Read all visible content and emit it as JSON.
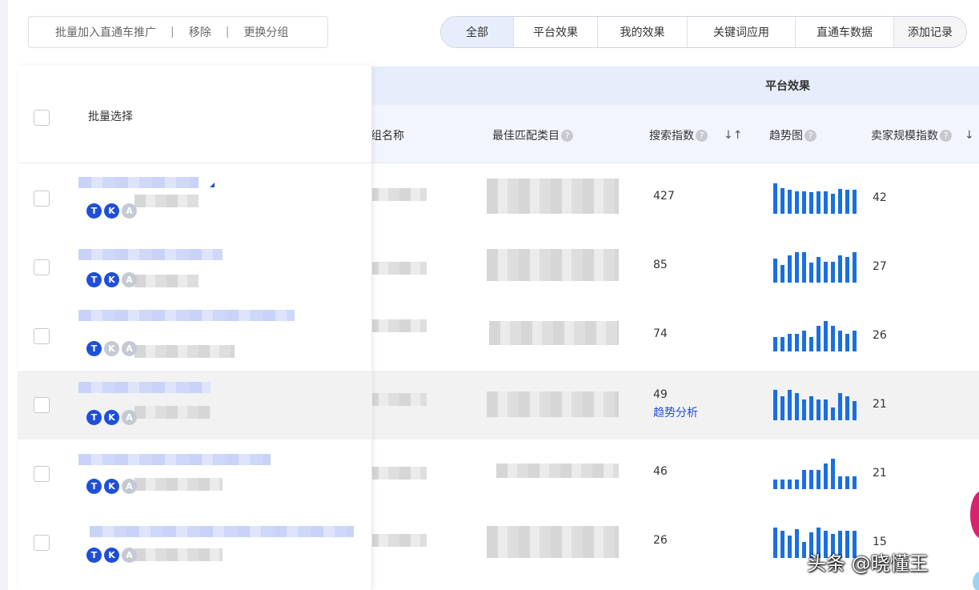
{
  "toolbar": {
    "batch_add": "批量加入直通车推广",
    "remove": "移除",
    "change_group": "更换分组"
  },
  "tabs": [
    {
      "label": "全部",
      "active": true
    },
    {
      "label": "平台效果",
      "active": false
    },
    {
      "label": "我的效果",
      "active": false
    },
    {
      "label": "关键词应用",
      "active": false
    },
    {
      "label": "直通车数据",
      "active": false
    },
    {
      "label": "添加记录",
      "active": false
    }
  ],
  "table": {
    "batch_select_label": "批量选择",
    "group_header": "平台效果",
    "columns": {
      "group_name": "组名称",
      "best_category": "最佳匹配类目",
      "search_index": "搜索指数",
      "trend_chart": "趋势图",
      "seller_scale": "卖家规模指数"
    },
    "trend_analysis_link": "趋势分析",
    "rows": [
      {
        "search_index": "427",
        "seller_scale": "42",
        "badges": [
          "T",
          "K",
          "A"
        ],
        "badge_active": [
          true,
          true,
          false
        ],
        "trend": [
          0.95,
          0.8,
          0.75,
          0.7,
          0.7,
          0.68,
          0.7,
          0.7,
          0.62,
          0.78,
          0.76,
          0.76
        ]
      },
      {
        "search_index": "85",
        "seller_scale": "27",
        "badges": [
          "T",
          "K",
          "A"
        ],
        "badge_active": [
          true,
          true,
          false
        ],
        "trend": [
          0.75,
          0.55,
          0.85,
          0.95,
          0.95,
          0.62,
          0.8,
          0.65,
          0.65,
          0.85,
          0.8,
          0.95
        ]
      },
      {
        "search_index": "74",
        "seller_scale": "26",
        "badges": [
          "T",
          "K",
          "A"
        ],
        "badge_active": [
          true,
          false,
          false
        ],
        "trend": [
          0.45,
          0.45,
          0.55,
          0.55,
          0.65,
          0.45,
          0.8,
          0.95,
          0.8,
          0.65,
          0.55,
          0.65
        ]
      },
      {
        "search_index": "49",
        "seller_scale": "21",
        "badges": [
          "T",
          "K",
          "A"
        ],
        "badge_active": [
          true,
          true,
          false
        ],
        "trend": [
          0.95,
          0.75,
          0.95,
          0.85,
          0.65,
          0.75,
          0.65,
          0.65,
          0.4,
          0.85,
          0.75,
          0.6
        ],
        "highlight": true
      },
      {
        "search_index": "46",
        "seller_scale": "21",
        "badges": [
          "T",
          "K",
          "A"
        ],
        "badge_active": [
          true,
          true,
          false
        ],
        "trend": [
          0.3,
          0.3,
          0.3,
          0.3,
          0.6,
          0.6,
          0.6,
          0.8,
          0.95,
          0.4,
          0.4,
          0.4
        ]
      },
      {
        "search_index": "26",
        "seller_scale": "15",
        "badges": [
          "T",
          "K",
          "A"
        ],
        "badge_active": [
          true,
          true,
          false
        ],
        "trend": [
          0.95,
          0.85,
          0.7,
          0.9,
          0.5,
          0.8,
          0.95,
          0.85,
          0.75,
          0.85,
          0.85,
          0.85
        ]
      }
    ]
  },
  "watermark": "头条 @晓懂王",
  "colors": {
    "accent": "#1f4fd8",
    "bar": "#1a6fe0",
    "header_bg": "#e8edfb"
  }
}
